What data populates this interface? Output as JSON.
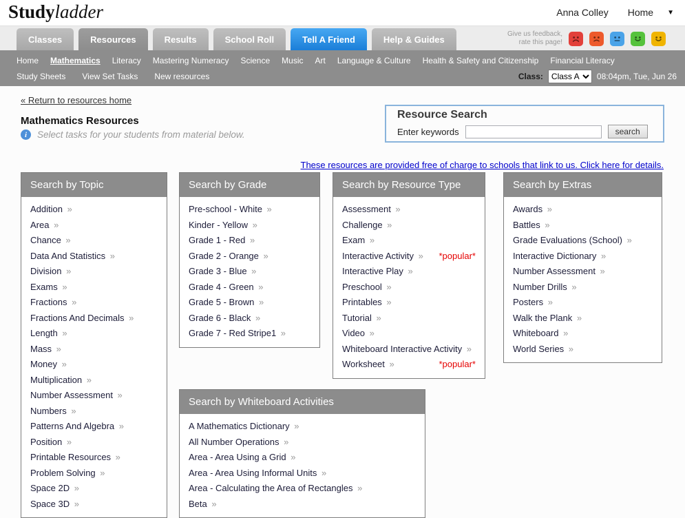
{
  "header": {
    "logo_study": "Study",
    "logo_ladder": "ladder",
    "user_name": "Anna Colley",
    "home_label": "Home"
  },
  "icons": {
    "chevron": "»",
    "caret": "▼",
    "info": "i"
  },
  "tabs": [
    {
      "label": "Classes",
      "variant": "default"
    },
    {
      "label": "Resources",
      "variant": "active"
    },
    {
      "label": "Results",
      "variant": "default"
    },
    {
      "label": "School Roll",
      "variant": "default"
    },
    {
      "label": "Tell A Friend",
      "variant": "blue"
    },
    {
      "label": "Help & Guides",
      "variant": "default"
    }
  ],
  "feedback": {
    "line1": "Give us feedback,",
    "line2": "rate this page!",
    "faces": [
      {
        "name": "angry",
        "color": "#e2403a",
        "mouth": "angry"
      },
      {
        "name": "unhappy",
        "color": "#ed5a2c",
        "mouth": "sad"
      },
      {
        "name": "neutral",
        "color": "#4aa3e8",
        "mouth": "neutral"
      },
      {
        "name": "happy",
        "color": "#55c23c",
        "mouth": "happy"
      },
      {
        "name": "very-happy",
        "color": "#f0b400",
        "mouth": "happy"
      }
    ]
  },
  "navbar": {
    "row1": [
      "Home",
      "Mathematics",
      "Literacy",
      "Mastering Numeracy",
      "Science",
      "Music",
      "Art",
      "Language & Culture",
      "Health & Safety and Citizenship",
      "Financial Literacy"
    ],
    "active_item": "Mathematics",
    "row2": [
      "Study Sheets",
      "View Set Tasks",
      "New resources"
    ],
    "class_label": "Class:",
    "class_value": "Class A",
    "datetime": "08:04pm, Tue, Jun 26"
  },
  "main": {
    "return_link": "« Return to resources home",
    "page_title": "Mathematics Resources",
    "note": "Select tasks for your students from material below.",
    "free_link": "These resources are provided free of charge to schools that link to us. Click here for details."
  },
  "search_box": {
    "title": "Resource Search",
    "label": "Enter keywords",
    "button": "search"
  },
  "boxes": {
    "topic": {
      "title": "Search by Topic",
      "items": [
        "Addition",
        "Area",
        "Chance",
        "Data And Statistics",
        "Division",
        "Exams",
        "Fractions",
        "Fractions And Decimals",
        "Length",
        "Mass",
        "Money",
        "Multiplication",
        "Number Assessment",
        "Numbers",
        "Patterns And Algebra",
        "Position",
        "Printable Resources",
        "Problem Solving",
        "Space 2D",
        "Space 3D"
      ]
    },
    "grade": {
      "title": "Search by Grade",
      "items": [
        "Pre-school - White",
        "Kinder - Yellow",
        "Grade 1 - Red",
        "Grade 2 - Orange",
        "Grade 3 - Blue",
        "Grade 4 - Green",
        "Grade 5 - Brown",
        "Grade 6 - Black",
        "Grade 7 - Red Stripe1"
      ]
    },
    "resource_type": {
      "title": "Search by Resource Type",
      "items": [
        {
          "label": "Assessment"
        },
        {
          "label": "Challenge"
        },
        {
          "label": "Exam"
        },
        {
          "label": "Interactive Activity",
          "tag": "*popular*"
        },
        {
          "label": "Interactive Play"
        },
        {
          "label": "Preschool"
        },
        {
          "label": "Printables"
        },
        {
          "label": "Tutorial"
        },
        {
          "label": "Video"
        },
        {
          "label": "Whiteboard Interactive Activity"
        },
        {
          "label": "Worksheet",
          "tag": "*popular*"
        }
      ]
    },
    "extras": {
      "title": "Search by Extras",
      "items": [
        "Awards",
        "Battles",
        "Grade Evaluations (School)",
        "Interactive Dictionary",
        "Number Assessment",
        "Number Drills",
        "Posters",
        "Walk the Plank",
        "Whiteboard",
        "World Series"
      ]
    },
    "whiteboard": {
      "title": "Search by Whiteboard Activities",
      "items": [
        "A Mathematics Dictionary",
        "All Number Operations",
        "Area - Area Using a Grid",
        "Area - Area Using Informal Units",
        "Area - Calculating the Area of Rectangles",
        "Beta"
      ]
    }
  }
}
